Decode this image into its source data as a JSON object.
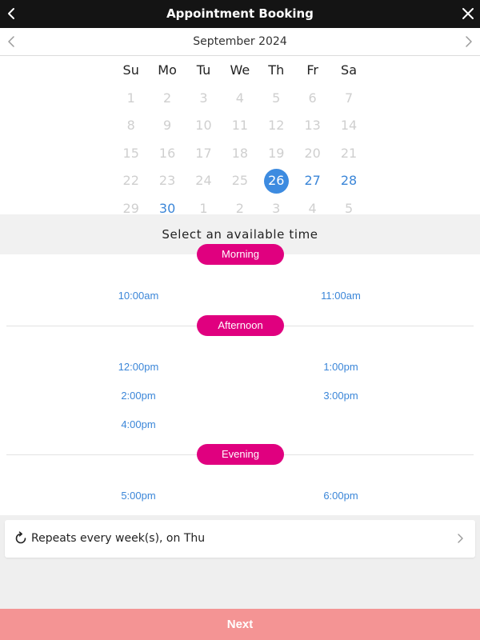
{
  "header": {
    "title": "Appointment Booking",
    "back_icon": "chevron-left-icon",
    "close_icon": "close-icon"
  },
  "calendar": {
    "month_label": "September 2024",
    "weekdays": [
      "Su",
      "Mo",
      "Tu",
      "We",
      "Th",
      "Fr",
      "Sa"
    ],
    "weeks": [
      [
        {
          "d": "1",
          "s": "off"
        },
        {
          "d": "2",
          "s": "off"
        },
        {
          "d": "3",
          "s": "off"
        },
        {
          "d": "4",
          "s": "off"
        },
        {
          "d": "5",
          "s": "off"
        },
        {
          "d": "6",
          "s": "off"
        },
        {
          "d": "7",
          "s": "off"
        }
      ],
      [
        {
          "d": "8",
          "s": "off"
        },
        {
          "d": "9",
          "s": "off"
        },
        {
          "d": "10",
          "s": "off"
        },
        {
          "d": "11",
          "s": "off"
        },
        {
          "d": "12",
          "s": "off"
        },
        {
          "d": "13",
          "s": "off"
        },
        {
          "d": "14",
          "s": "off"
        }
      ],
      [
        {
          "d": "15",
          "s": "off"
        },
        {
          "d": "16",
          "s": "off"
        },
        {
          "d": "17",
          "s": "off"
        },
        {
          "d": "18",
          "s": "off"
        },
        {
          "d": "19",
          "s": "off"
        },
        {
          "d": "20",
          "s": "off"
        },
        {
          "d": "21",
          "s": "off"
        }
      ],
      [
        {
          "d": "22",
          "s": "off"
        },
        {
          "d": "23",
          "s": "off"
        },
        {
          "d": "24",
          "s": "off"
        },
        {
          "d": "25",
          "s": "off"
        },
        {
          "d": "26",
          "s": "selected"
        },
        {
          "d": "27",
          "s": "avail"
        },
        {
          "d": "28",
          "s": "avail"
        }
      ],
      [
        {
          "d": "29",
          "s": "off"
        },
        {
          "d": "30",
          "s": "avail"
        },
        {
          "d": "1",
          "s": "off"
        },
        {
          "d": "2",
          "s": "off"
        },
        {
          "d": "3",
          "s": "off"
        },
        {
          "d": "4",
          "s": "off"
        },
        {
          "d": "5",
          "s": "off"
        }
      ]
    ],
    "selected_color": "#3d8be0",
    "available_color": "#3b86d8"
  },
  "time_section": {
    "heading": "Select an available time",
    "groups": [
      {
        "label": "Morning",
        "slots": [
          "10:00am",
          "11:00am"
        ]
      },
      {
        "label": "Afternoon",
        "slots": [
          "12:00pm",
          "1:00pm",
          "2:00pm",
          "3:00pm",
          "4:00pm"
        ]
      },
      {
        "label": "Evening",
        "slots": [
          "5:00pm",
          "6:00pm"
        ]
      }
    ],
    "pill_color": "#e0007f"
  },
  "repeat": {
    "text": "Repeats every week(s), on Thu",
    "icon": "refresh-icon"
  },
  "footer": {
    "next_label": "Next",
    "color": "#f49494"
  }
}
